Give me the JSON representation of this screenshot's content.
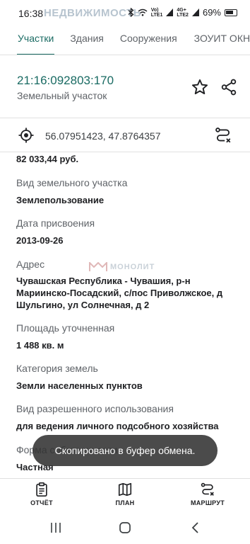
{
  "status_bar": {
    "time": "16:38",
    "watermark": "НЕДВИЖИМОСТЬ",
    "signal_tag_1": "LTE1",
    "signal_tag_2": "LTE2",
    "network": "4G+",
    "battery": "69%"
  },
  "tabs": [
    {
      "label": "Участки",
      "active": true
    },
    {
      "label": "Здания",
      "active": false
    },
    {
      "label": "Сооружения",
      "active": false
    },
    {
      "label": "ЗОУИТ ОКН",
      "active": false
    }
  ],
  "header": {
    "cadastral_number": "21:16:092803:170",
    "object_type": "Земельный участок"
  },
  "coordinates": {
    "text": "56.07951423, 47.8764357"
  },
  "details": {
    "cut_value": "82 033,44 руб.",
    "fields": [
      {
        "label": "Вид земельного участка",
        "value": "Землепользование"
      },
      {
        "label": "Дата присвоения",
        "value": "2013-09-26"
      },
      {
        "label": "Адрес",
        "value": "Чувашская Республика - Чувашия, р-н Мариинско-Посадский, с/пос Приволжское, д Шульгино, ул Солнечная, д 2"
      },
      {
        "label": "Площадь уточненная",
        "value": "1 488 кв. м"
      },
      {
        "label": "Категория земель",
        "value": "Земли населенных пунктов"
      },
      {
        "label": "Вид разрешенного использования",
        "value": "для ведения личного подсобного хозяйства"
      },
      {
        "label": "Форма собственности",
        "value": "Частная"
      }
    ]
  },
  "watermark_mid": "МОНОЛИТ",
  "toast": "Скопировано в буфер обмена.",
  "bottom_nav": {
    "report": "ОТЧЁТ",
    "plan": "ПЛАН",
    "route": "МАРШРУТ"
  },
  "colors": {
    "accent": "#1a6b63",
    "toast_bg": "#323232"
  }
}
